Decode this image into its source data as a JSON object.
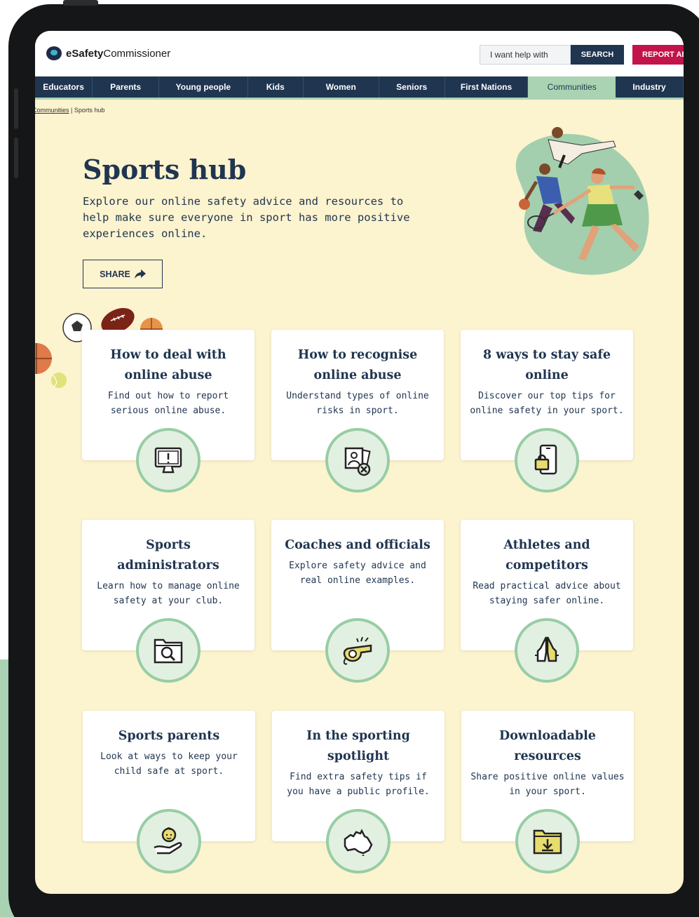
{
  "header": {
    "logo_bold": "eSafety",
    "logo_regular": "Commissioner",
    "help_placeholder": "I want help with",
    "search_label": "SEARCH",
    "report_label": "REPORT AB"
  },
  "nav": {
    "items": [
      {
        "label": "Educators"
      },
      {
        "label": "Parents"
      },
      {
        "label": "Young people"
      },
      {
        "label": "Kids"
      },
      {
        "label": "Women"
      },
      {
        "label": "Seniors"
      },
      {
        "label": "First Nations"
      },
      {
        "label": "Communities",
        "active": true
      },
      {
        "label": "Industry"
      }
    ]
  },
  "breadcrumb": {
    "parent": "Communities",
    "separator": "|",
    "current": "Sports hub"
  },
  "hero": {
    "title": "Sports hub",
    "intro": "Explore our online safety advice and resources to help make sure everyone in sport has more positive experiences online.",
    "share_label": "SHARE"
  },
  "cards": [
    {
      "title": "How to deal with online abuse",
      "desc": "Find out how to report serious online abuse.",
      "icon": "monitor-alert-icon"
    },
    {
      "title": "How to recognise online abuse",
      "desc": "Understand types of online risks in sport.",
      "icon": "photo-cross-icon"
    },
    {
      "title": "8 ways to stay safe online",
      "desc": "Discover our top tips for online safety in your sport.",
      "icon": "phone-lock-icon"
    },
    {
      "title": "Sports administrators",
      "desc": "Learn how to manage online safety at your club.",
      "icon": "folder-search-icon"
    },
    {
      "title": "Coaches and officials",
      "desc": "Explore safety advice and real online examples.",
      "icon": "whistle-icon"
    },
    {
      "title": "Athletes and competitors",
      "desc": "Read practical advice about staying safer online.",
      "icon": "hands-icon"
    },
    {
      "title": "Sports parents",
      "desc": "Look at ways to keep your child safe at sport.",
      "icon": "baby-hand-icon"
    },
    {
      "title": "In the sporting spotlight",
      "desc": "Find extra safety tips if you have a public profile.",
      "icon": "australia-map-icon"
    },
    {
      "title": "Downloadable resources",
      "desc": "Share positive online values in your sport.",
      "icon": "folder-download-icon"
    }
  ],
  "colors": {
    "navy": "#1f3550",
    "page_bg": "#fcf3cf",
    "accent_green": "#a9d3b2",
    "report_red": "#c3134b"
  }
}
